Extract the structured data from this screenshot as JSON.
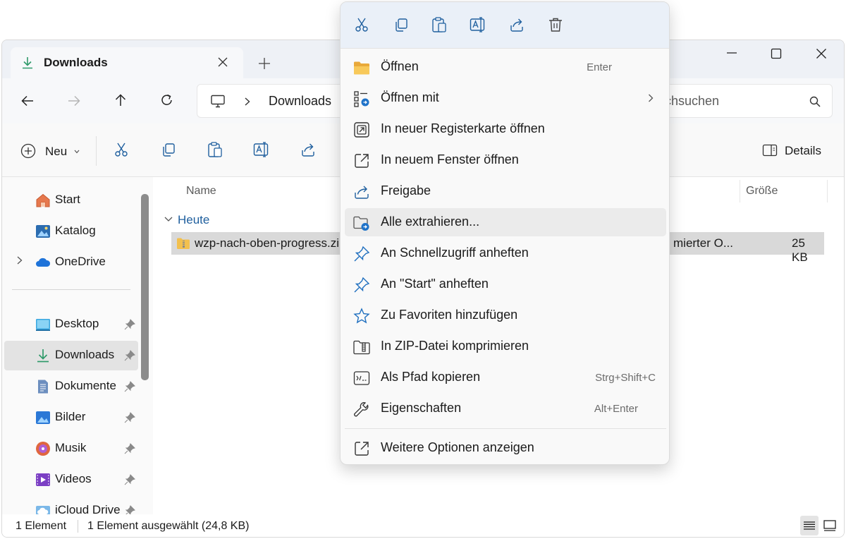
{
  "window": {
    "tab_title": "Downloads",
    "breadcrumb": "Downloads",
    "search_placeholder": "Downloads durchsuchen",
    "search_visible_text": "rchsuchen"
  },
  "toolbar": {
    "new_label": "Neu",
    "details_label": "Details"
  },
  "sidebar": {
    "items": [
      {
        "label": "Start",
        "icon": "home-icon"
      },
      {
        "label": "Katalog",
        "icon": "gallery-icon"
      },
      {
        "label": "OneDrive",
        "icon": "onedrive-icon"
      },
      {
        "label": "Desktop",
        "icon": "desktop-icon"
      },
      {
        "label": "Downloads",
        "icon": "downloads-icon"
      },
      {
        "label": "Dokumente",
        "icon": "documents-icon"
      },
      {
        "label": "Bilder",
        "icon": "pictures-icon"
      },
      {
        "label": "Musik",
        "icon": "music-icon"
      },
      {
        "label": "Videos",
        "icon": "videos-icon"
      },
      {
        "label": "iCloud Drive",
        "icon": "icloud-icon"
      }
    ]
  },
  "content": {
    "col_name": "Name",
    "col_size": "Größe",
    "group_label": "Heute",
    "file": {
      "name": "wzp-nach-oben-progress.zip",
      "type_visible": "mierter O...",
      "size": "25 KB"
    }
  },
  "status": {
    "count": "1 Element",
    "selected": "1 Element ausgewählt (24,8 KB)"
  },
  "context_menu": {
    "items": [
      {
        "label": "Öffnen",
        "shortcut": "Enter",
        "icon": "folder-icon"
      },
      {
        "label": "Öffnen mit",
        "shortcut": "",
        "icon": "open-with-icon"
      },
      {
        "label": "In neuer Registerkarte öffnen",
        "shortcut": "",
        "icon": "new-tab-icon"
      },
      {
        "label": "In neuem Fenster öffnen",
        "shortcut": "",
        "icon": "new-window-icon"
      },
      {
        "label": "Freigabe",
        "shortcut": "",
        "icon": "share-icon"
      },
      {
        "label": "Alle extrahieren...",
        "shortcut": "",
        "icon": "extract-icon"
      },
      {
        "label": "An Schnellzugriff anheften",
        "shortcut": "",
        "icon": "pin-icon"
      },
      {
        "label": "An \"Start\" anheften",
        "shortcut": "",
        "icon": "pin-start-icon"
      },
      {
        "label": "Zu Favoriten hinzufügen",
        "shortcut": "",
        "icon": "star-icon"
      },
      {
        "label": "In ZIP-Datei komprimieren",
        "shortcut": "",
        "icon": "zip-icon"
      },
      {
        "label": "Als Pfad kopieren",
        "shortcut": "Strg+Shift+C",
        "icon": "copy-path-icon"
      },
      {
        "label": "Eigenschaften",
        "shortcut": "Alt+Enter",
        "icon": "wrench-icon"
      },
      {
        "label": "Weitere Optionen anzeigen",
        "shortcut": "",
        "icon": "more-options-icon"
      }
    ]
  }
}
